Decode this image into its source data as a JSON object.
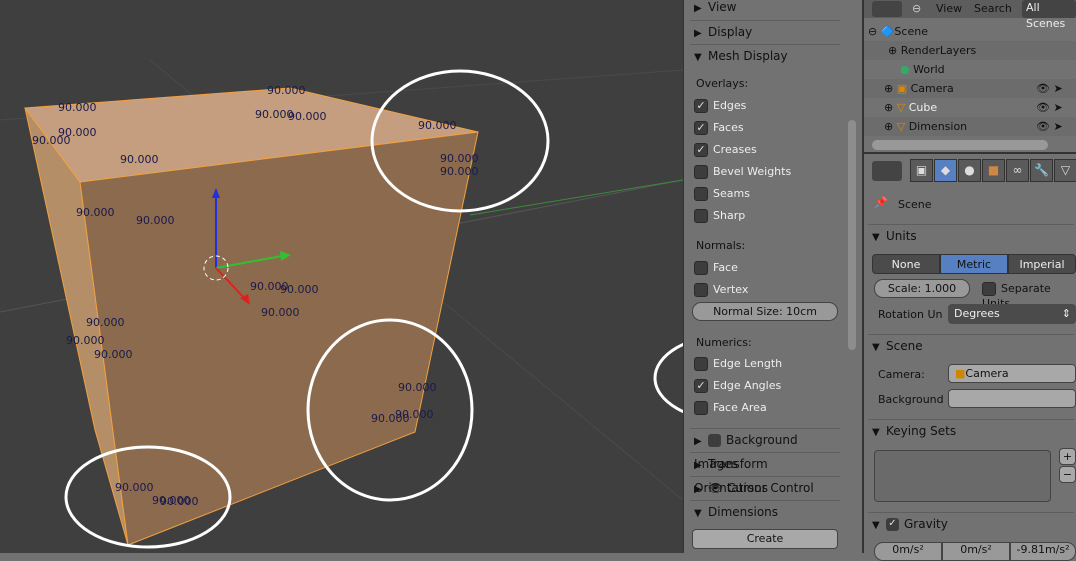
{
  "viewport": {
    "labels": [
      "90.000",
      "90.000",
      "90.000",
      "90.000",
      "90.000",
      "90.000",
      "90.000",
      "90.000",
      "90.000",
      "90.000",
      "90.000",
      "90.000",
      "90.000",
      "90.000",
      "90.000",
      "90.000",
      "90.000",
      "90.000",
      "90.000",
      "90.000",
      "90.000",
      "90.000",
      "90.000",
      "90.000"
    ],
    "face_color": "#a07a52",
    "edge_color": "#f3a040"
  },
  "npanel": {
    "view": "View",
    "display": "Display",
    "mesh_display": "Mesh Display",
    "overlays": "Overlays:",
    "edges": "Edges",
    "faces": "Faces",
    "creases": "Creases",
    "bevel_weights": "Bevel Weights",
    "seams": "Seams",
    "sharp": "Sharp",
    "normals": "Normals:",
    "face": "Face",
    "vertex": "Vertex",
    "normal_size": "Normal Size: 10cm",
    "numerics": "Numerics:",
    "edge_length": "Edge Length",
    "edge_angles": "Edge Angles",
    "face_area": "Face Area",
    "background_images": "Background Images",
    "transform_orientations": "Transform Orientations",
    "cursor_control": "Cursor Control",
    "dimensions": "Dimensions",
    "create": "Create",
    "check": "✓"
  },
  "outliner": {
    "view": "View",
    "search": "Search",
    "filter": "All Scenes",
    "items": [
      "Scene",
      "RenderLayers",
      "World",
      "Camera",
      "Cube",
      "Dimension"
    ]
  },
  "props": {
    "context": "Scene",
    "units": "Units",
    "none": "None",
    "metric": "Metric",
    "imperial": "Imperial",
    "scale": "Scale: 1.000",
    "separate_units": "Separate Units",
    "rotation_label": "Rotation Un",
    "rotation_value": "Degrees",
    "scene": "Scene",
    "camera_label": "Camera:",
    "camera_value": "Camera",
    "background_label": "Background",
    "keying_sets": "Keying Sets",
    "plus": "+",
    "minus": "−",
    "gravity": "Gravity",
    "gx": "0m/s²",
    "gy": "0m/s²",
    "gz": "-9.81m/s²",
    "accent": "#5680c2"
  }
}
